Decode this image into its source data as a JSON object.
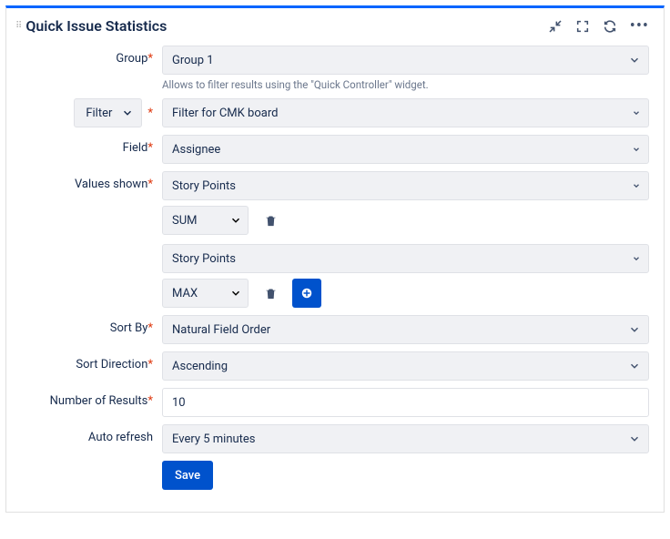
{
  "header": {
    "title": "Quick Issue Statistics"
  },
  "labels": {
    "group": "Group",
    "filter": "Filter",
    "field": "Field",
    "values_shown": "Values shown",
    "sort_by": "Sort By",
    "sort_direction": "Sort Direction",
    "number_of_results": "Number of Results",
    "auto_refresh": "Auto refresh",
    "save": "Save"
  },
  "values": {
    "group": "Group 1",
    "group_helper": "Allows to filter results using the \"Quick Controller\" widget.",
    "filter": "Filter for CMK board",
    "field": "Assignee",
    "values_shown": [
      {
        "field": "Story Points",
        "agg": "SUM"
      },
      {
        "field": "Story Points",
        "agg": "MAX"
      }
    ],
    "sort_by": "Natural Field Order",
    "sort_direction": "Ascending",
    "number_of_results": "10",
    "auto_refresh": "Every 5 minutes"
  }
}
